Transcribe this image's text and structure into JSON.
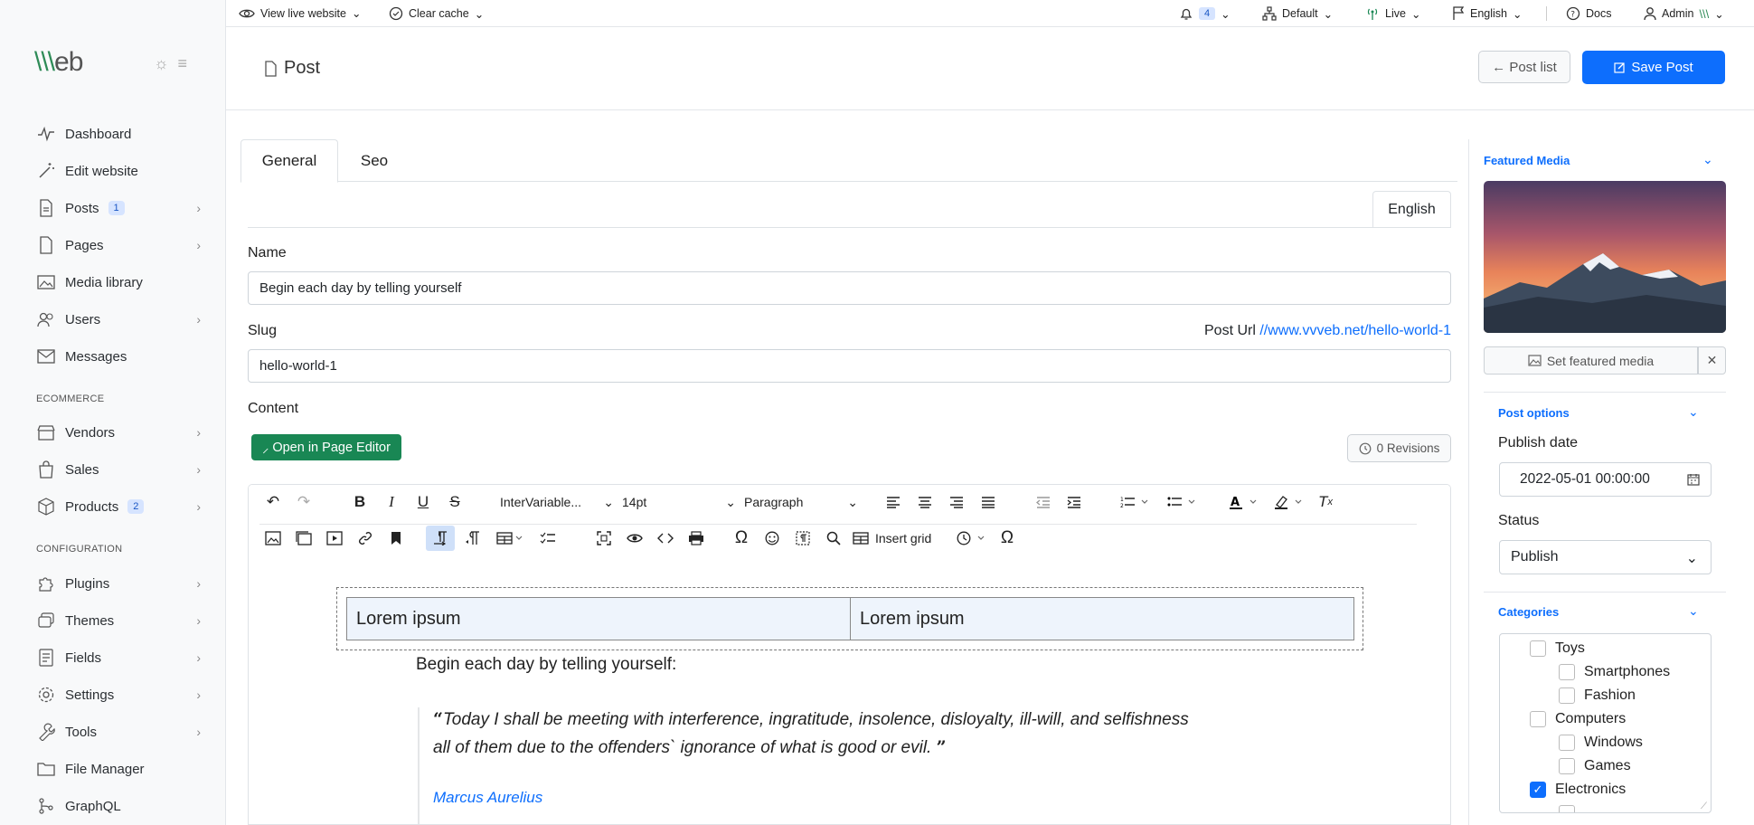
{
  "app": {
    "logo_text": "vvveb"
  },
  "topbar": {
    "view_live": "View live website",
    "clear_cache": "Clear cache",
    "notifications_count": "4",
    "site": "Default",
    "mode": "Live",
    "language": "English",
    "docs": "Docs",
    "user": "Admin"
  },
  "sidebar": {
    "items": [
      {
        "label": "Dashboard",
        "icon": "activity-icon"
      },
      {
        "label": "Edit website",
        "icon": "magic-wand-icon"
      },
      {
        "label": "Posts",
        "icon": "document-icon",
        "badge": "1",
        "chevron": true
      },
      {
        "label": "Pages",
        "icon": "page-icon",
        "chevron": true
      },
      {
        "label": "Media library",
        "icon": "image-icon"
      },
      {
        "label": "Users",
        "icon": "users-icon",
        "chevron": true
      },
      {
        "label": "Messages",
        "icon": "mail-icon"
      }
    ],
    "section_ecommerce": "ECOMMERCE",
    "ecommerce_items": [
      {
        "label": "Vendors",
        "icon": "store-icon",
        "chevron": true
      },
      {
        "label": "Sales",
        "icon": "bag-icon",
        "chevron": true
      },
      {
        "label": "Products",
        "icon": "box-icon",
        "badge": "2",
        "chevron": true
      }
    ],
    "section_configuration": "CONFIGURATION",
    "config_items": [
      {
        "label": "Plugins",
        "icon": "puzzle-icon",
        "chevron": true
      },
      {
        "label": "Themes",
        "icon": "layers-icon",
        "chevron": true
      },
      {
        "label": "Fields",
        "icon": "form-icon",
        "chevron": true
      },
      {
        "label": "Settings",
        "icon": "gear-icon",
        "chevron": true
      },
      {
        "label": "Tools",
        "icon": "wrench-icon",
        "chevron": true
      },
      {
        "label": "File Manager",
        "icon": "folder-icon"
      },
      {
        "label": "GraphQL",
        "icon": "graph-icon"
      }
    ]
  },
  "header": {
    "title": "Post",
    "post_list_label": "Post list",
    "save_label": "Save Post"
  },
  "tabs": {
    "general": "General",
    "seo": "Seo",
    "language": "English"
  },
  "form": {
    "name_label": "Name",
    "name_value": "Begin each day by telling yourself",
    "slug_label": "Slug",
    "slug_value": "hello-world-1",
    "post_url_label": "Post Url",
    "post_url_value": "//www.vvveb.net/hello-world-1",
    "content_label": "Content",
    "open_editor_label": "Open in Page Editor",
    "revisions_label": "0 Revisions"
  },
  "editor": {
    "font_family": "InterVariable...",
    "font_size": "14pt",
    "block_format": "Paragraph",
    "insert_grid_label": "Insert grid",
    "table_cells": [
      "Lorem ipsum",
      "Lorem ipsum"
    ],
    "intro": "Begin each day by telling yourself:",
    "quote_line1": "Today I shall be meeting with interference, ingratitude, insolence, disloyalty, ill-will, and selfishness",
    "quote_line2": "all of them due to the offenders` ignorance of what is good or evil.",
    "quote_author": "Marcus Aurelius"
  },
  "right_panel": {
    "featured_media_title": "Featured Media",
    "set_featured_label": "Set featured media",
    "post_options_title": "Post options",
    "publish_date_label": "Publish date",
    "publish_date_value": "2022-05-01 00:00:00",
    "status_label": "Status",
    "status_value": "Publish",
    "categories_title": "Categories",
    "categories": [
      {
        "label": "Toys",
        "level": 1,
        "checked": false
      },
      {
        "label": "Smartphones",
        "level": 2,
        "checked": false
      },
      {
        "label": "Fashion",
        "level": 2,
        "checked": false
      },
      {
        "label": "Computers",
        "level": 1,
        "checked": false
      },
      {
        "label": "Windows",
        "level": 2,
        "checked": false
      },
      {
        "label": "Games",
        "level": 2,
        "checked": false
      },
      {
        "label": "Electronics",
        "level": 1,
        "checked": true
      }
    ]
  },
  "colors": {
    "accent": "#0d6efd",
    "green": "#198754",
    "badge_bg": "#d6e4ff"
  }
}
